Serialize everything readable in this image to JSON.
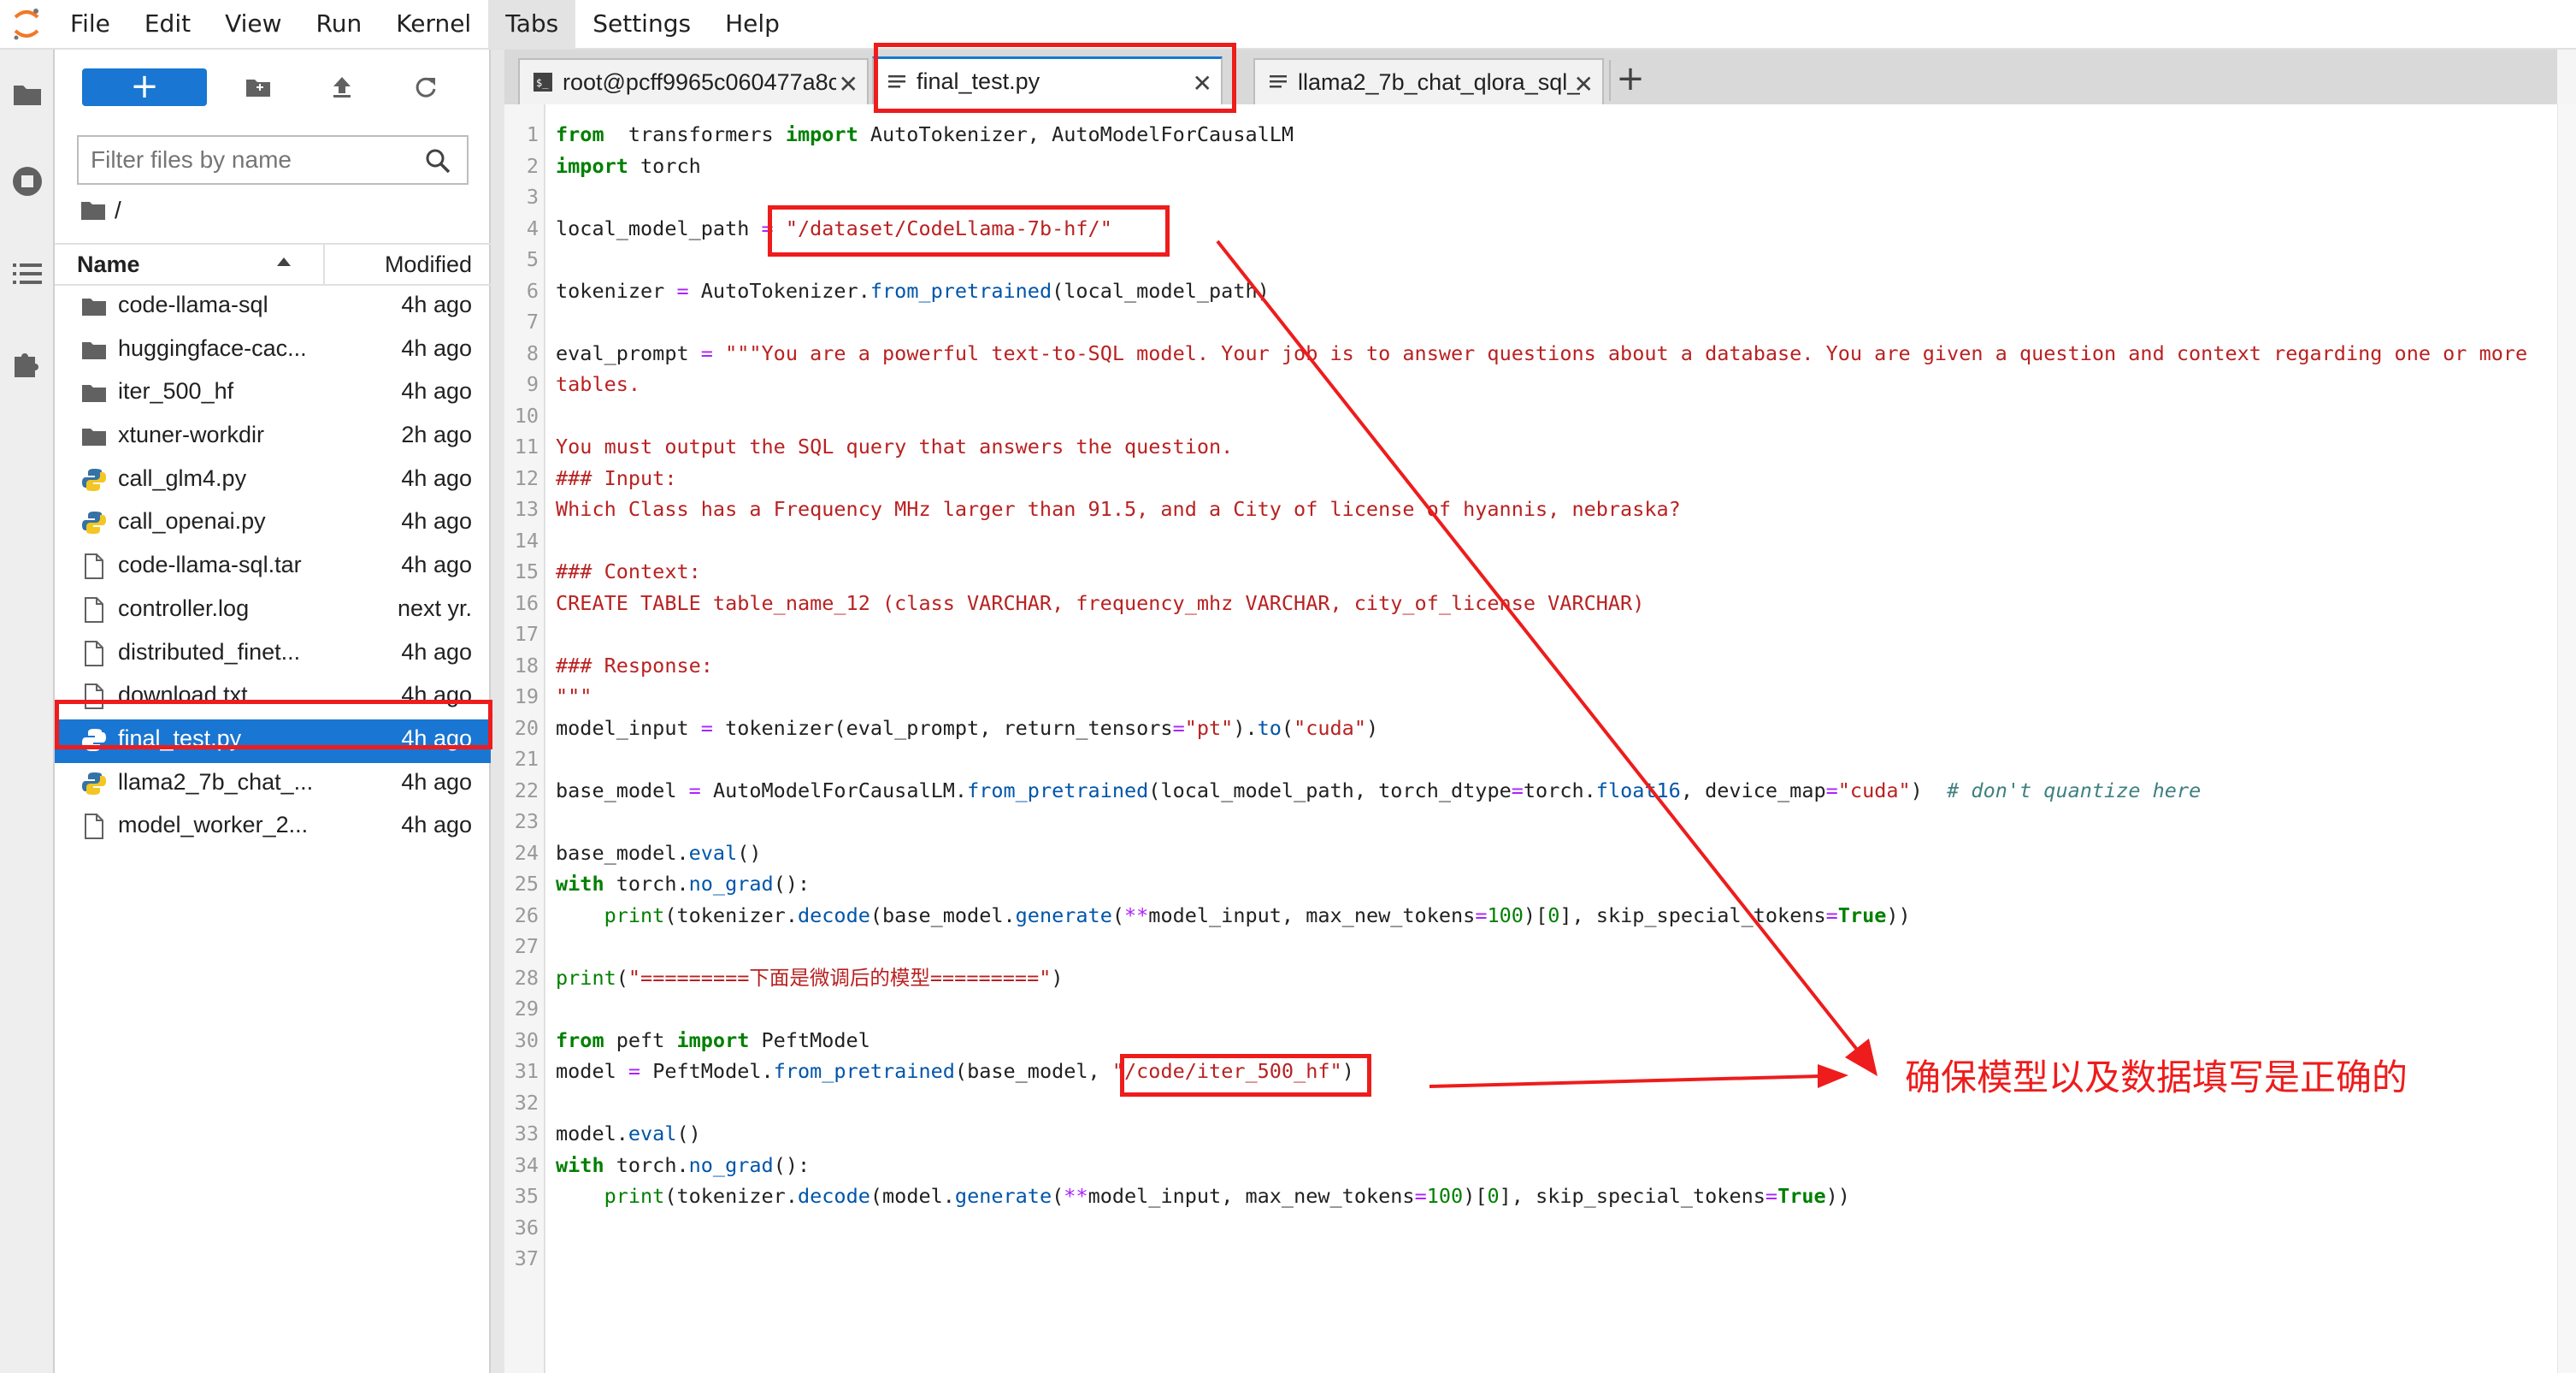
{
  "menubar": {
    "items": [
      "File",
      "Edit",
      "View",
      "Run",
      "Kernel",
      "Tabs",
      "Settings",
      "Help"
    ],
    "active_index": 5
  },
  "activity_bar": {
    "icons": [
      "folder-icon",
      "running-icon",
      "toc-icon",
      "extension-icon"
    ]
  },
  "file_browser": {
    "new_button_label": "+",
    "filter_placeholder": "Filter files by name",
    "breadcrumb": "/",
    "columns": {
      "name": "Name",
      "modified": "Modified"
    },
    "files": [
      {
        "name": "code-llama-sql",
        "modified": "4h ago",
        "icon": "folder-icon"
      },
      {
        "name": "huggingface-cac...",
        "modified": "4h ago",
        "icon": "folder-icon"
      },
      {
        "name": "iter_500_hf",
        "modified": "4h ago",
        "icon": "folder-icon"
      },
      {
        "name": "xtuner-workdir",
        "modified": "2h ago",
        "icon": "folder-icon"
      },
      {
        "name": "call_glm4.py",
        "modified": "4h ago",
        "icon": "python-file-icon"
      },
      {
        "name": "call_openai.py",
        "modified": "4h ago",
        "icon": "python-file-icon"
      },
      {
        "name": "code-llama-sql.tar",
        "modified": "4h ago",
        "icon": "file-icon"
      },
      {
        "name": "controller.log",
        "modified": "next yr.",
        "icon": "file-icon"
      },
      {
        "name": "distributed_finet...",
        "modified": "4h ago",
        "icon": "file-icon"
      },
      {
        "name": "download.txt",
        "modified": "4h ago",
        "icon": "file-icon"
      },
      {
        "name": "final_test.py",
        "modified": "4h ago",
        "icon": "python-file-icon",
        "selected": true
      },
      {
        "name": "llama2_7b_chat_...",
        "modified": "4h ago",
        "icon": "python-file-icon"
      },
      {
        "name": "model_worker_2...",
        "modified": "4h ago",
        "icon": "file-icon"
      }
    ]
  },
  "tabs": [
    {
      "label": "root@pcff9965c060477a8c",
      "icon": "terminal-icon",
      "current": false
    },
    {
      "label": "final_test.py",
      "icon": "text-file-icon",
      "current": true
    },
    {
      "label": "llama2_7b_chat_qlora_sql_...",
      "icon": "text-file-icon",
      "current": false
    }
  ],
  "editor": {
    "lines": [
      [
        [
          "kw",
          "from"
        ],
        [
          "",
          "  transformers "
        ],
        [
          "kw",
          "import"
        ],
        [
          "",
          " AutoTokenizer, AutoModelForCausalLM"
        ]
      ],
      [
        [
          "kw",
          "import"
        ],
        [
          "",
          " torch"
        ]
      ],
      [],
      [
        [
          "",
          "local_model_path "
        ],
        [
          "op",
          "="
        ],
        [
          "",
          " "
        ],
        [
          "st",
          "\"/dataset/CodeLlama-7b-hf/\""
        ]
      ],
      [],
      [
        [
          "",
          "tokenizer "
        ],
        [
          "op",
          "="
        ],
        [
          "",
          " AutoTokenizer."
        ],
        [
          "fn",
          "from_pretrained"
        ],
        [
          "",
          "(local_model_path)"
        ]
      ],
      [],
      [
        [
          "",
          "eval_prompt "
        ],
        [
          "op",
          "="
        ],
        [
          "",
          " "
        ],
        [
          "st",
          "\"\"\"You are a powerful text-to-SQL model. Your job is to answer questions about a database. You are given a question and context regarding one or more"
        ]
      ],
      [
        [
          "st",
          "tables."
        ]
      ],
      [],
      [
        [
          "st",
          "You must output the SQL query that answers the question."
        ]
      ],
      [
        [
          "st",
          "### Input:"
        ]
      ],
      [
        [
          "st",
          "Which Class has a Frequency MHz larger than 91.5, and a City of license of hyannis, nebraska?"
        ]
      ],
      [],
      [
        [
          "st",
          "### Context:"
        ]
      ],
      [
        [
          "st",
          "CREATE TABLE table_name_12 (class VARCHAR, frequency_mhz VARCHAR, city_of_license VARCHAR)"
        ]
      ],
      [],
      [
        [
          "st",
          "### Response:"
        ]
      ],
      [
        [
          "st",
          "\"\"\""
        ]
      ],
      [
        [
          "",
          "model_input "
        ],
        [
          "op",
          "="
        ],
        [
          "",
          " tokenizer(eval_prompt, return_tensors"
        ],
        [
          "op",
          "="
        ],
        [
          "st",
          "\"pt\""
        ],
        [
          "",
          ")."
        ],
        [
          "fn",
          "to"
        ],
        [
          "",
          "("
        ],
        [
          "st",
          "\"cuda\""
        ],
        [
          "",
          ")"
        ]
      ],
      [],
      [
        [
          "",
          "base_model "
        ],
        [
          "op",
          "="
        ],
        [
          "",
          " AutoModelForCausalLM."
        ],
        [
          "fn",
          "from_pretrained"
        ],
        [
          "",
          "(local_model_path, torch_dtype"
        ],
        [
          "op",
          "="
        ],
        [
          "",
          "torch."
        ],
        [
          "fn",
          "float16"
        ],
        [
          "",
          ", device_map"
        ],
        [
          "op",
          "="
        ],
        [
          "st",
          "\"cuda\""
        ],
        [
          "",
          ")  "
        ],
        [
          "cm",
          "# don't quantize here"
        ]
      ],
      [],
      [
        [
          "",
          "base_model."
        ],
        [
          "fn",
          "eval"
        ],
        [
          "",
          "()"
        ]
      ],
      [
        [
          "kw",
          "with"
        ],
        [
          "",
          " torch."
        ],
        [
          "fn",
          "no_grad"
        ],
        [
          "",
          "():"
        ]
      ],
      [
        [
          "",
          "    "
        ],
        [
          "nm",
          "print"
        ],
        [
          "",
          "(tokenizer."
        ],
        [
          "fn",
          "decode"
        ],
        [
          "",
          "(base_model."
        ],
        [
          "fn",
          "generate"
        ],
        [
          "",
          "("
        ],
        [
          "op",
          "**"
        ],
        [
          "",
          "model_input, max_new_tokens"
        ],
        [
          "op",
          "="
        ],
        [
          "nm",
          "100"
        ],
        [
          "",
          ")["
        ],
        [
          "nm",
          "0"
        ],
        [
          "",
          "], skip_special_tokens"
        ],
        [
          "op",
          "="
        ],
        [
          "kw",
          "True"
        ],
        [
          "",
          "))"
        ]
      ],
      [],
      [
        [
          "nm",
          "print"
        ],
        [
          "",
          "("
        ],
        [
          "st",
          "\"=========下面是微调后的模型=========\""
        ],
        [
          "",
          ")"
        ]
      ],
      [],
      [
        [
          "kw",
          "from"
        ],
        [
          "",
          " peft "
        ],
        [
          "kw",
          "import"
        ],
        [
          "",
          " PeftModel"
        ]
      ],
      [
        [
          "",
          "model "
        ],
        [
          "op",
          "="
        ],
        [
          "",
          " PeftModel."
        ],
        [
          "fn",
          "from_pretrained"
        ],
        [
          "",
          "(base_model, "
        ],
        [
          "st",
          "\"/code/iter_500_hf\""
        ],
        [
          "",
          ")"
        ]
      ],
      [],
      [
        [
          "",
          "model."
        ],
        [
          "fn",
          "eval"
        ],
        [
          "",
          "()"
        ]
      ],
      [
        [
          "kw",
          "with"
        ],
        [
          "",
          " torch."
        ],
        [
          "fn",
          "no_grad"
        ],
        [
          "",
          "():"
        ]
      ],
      [
        [
          "",
          "    "
        ],
        [
          "nm",
          "print"
        ],
        [
          "",
          "(tokenizer."
        ],
        [
          "fn",
          "decode"
        ],
        [
          "",
          "(model."
        ],
        [
          "fn",
          "generate"
        ],
        [
          "",
          "("
        ],
        [
          "op",
          "**"
        ],
        [
          "",
          "model_input, max_new_tokens"
        ],
        [
          "op",
          "="
        ],
        [
          "nm",
          "100"
        ],
        [
          "",
          ")["
        ],
        [
          "nm",
          "0"
        ],
        [
          "",
          "], skip_special_tokens"
        ],
        [
          "op",
          "="
        ],
        [
          "kw",
          "True"
        ],
        [
          "",
          "))"
        ]
      ],
      [],
      []
    ]
  },
  "annotation": {
    "text": "确保模型以及数据填写是正确的",
    "color": "#ee1c1c"
  },
  "colors": {
    "accent": "#1976d2",
    "annotation_red": "#ee1c1c"
  }
}
